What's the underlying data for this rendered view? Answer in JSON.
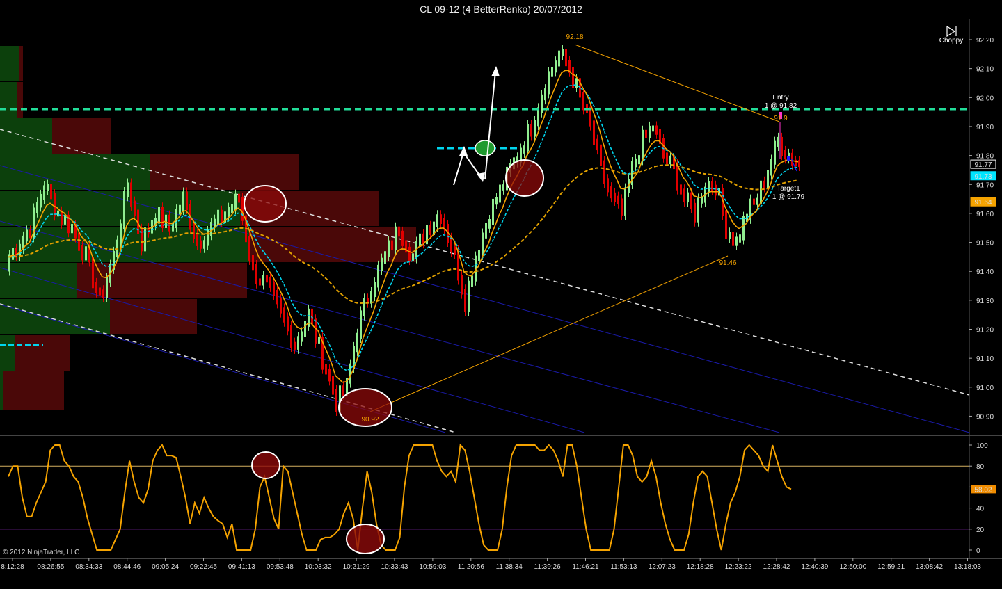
{
  "window": {
    "title": "CL 09-12 (4 BetterRenko)  20/07/2012"
  },
  "toolbar": {
    "choppy_label": "Choppy",
    "choppy_icon": "play-skip-icon"
  },
  "footer": {
    "copyright": "© 2012 NinjaTrader, LLC"
  },
  "price_axis": {
    "ticks": [
      "92.20",
      "92.10",
      "92.00",
      "91.90",
      "91.80",
      "91.70",
      "91.60",
      "91.50",
      "91.40",
      "91.30",
      "91.20",
      "91.10",
      "91.00",
      "90.90"
    ],
    "tags": [
      {
        "text": "91.77",
        "bg": "#000000",
        "fg": "#ffffff",
        "border": "#ffffff",
        "price": 91.77
      },
      {
        "text": "91.73",
        "bg": "#00e5ff",
        "fg": "#000000",
        "border": "#00e5ff",
        "price": 91.73
      },
      {
        "text": "91.64",
        "bg": "#f5a300",
        "fg": "#000000",
        "border": "#f5a300",
        "price": 91.64
      }
    ]
  },
  "osc_axis": {
    "ticks": [
      "100",
      "80",
      "60",
      "40",
      "20",
      "0"
    ],
    "tag": {
      "text": "58.02",
      "bg": "#f08c00",
      "fg": "#000000",
      "value": 58.02
    }
  },
  "time_axis": [
    "8:12:28",
    "08:26:55",
    "08:34:33",
    "08:44:46",
    "09:05:24",
    "09:22:45",
    "09:41:13",
    "09:53:48",
    "10:03:32",
    "10:21:29",
    "10:33:43",
    "10:59:03",
    "11:20:56",
    "11:38:34",
    "11:39:26",
    "11:46:21",
    "11:53:13",
    "12:07:23",
    "12:18:28",
    "12:23:22",
    "12:28:42",
    "12:40:39",
    "12:50:00",
    "12:59:21",
    "13:08:42",
    "13:18:03"
  ],
  "annotations": {
    "swing_high": "92.18",
    "swing_low": "90.92",
    "swing_mid_low": "91.46",
    "entry_title": "Entry",
    "entry_detail": "1 @ 91.82",
    "entry_price_label": "91.9",
    "target_title": "Target1",
    "target_detail": "1 @ 91.79"
  },
  "colors": {
    "up_bar": "#90ee90",
    "down_bar": "#e00000",
    "ema_fast": "#f5a300",
    "ema_cyan": "#00d5ee",
    "sma_slow": "#e0a000",
    "resistance_line": "#22dd99",
    "oscillator": "#f5a300",
    "osc_upper": "#d4b060",
    "osc_lower": "#9b30d0",
    "vol_profile_green": "#0c400c",
    "vol_profile_red": "#4a0808"
  },
  "chart_data": [
    {
      "type": "candlestick",
      "symbol": "CL 09-12",
      "bar_type": "4 BetterRenko",
      "date": "20/07/2012",
      "y_range": [
        90.85,
        92.25
      ],
      "close_path": [
        [
          0,
          91.45
        ],
        [
          6,
          91.55
        ],
        [
          10,
          91.7
        ],
        [
          14,
          91.6
        ],
        [
          18,
          91.55
        ],
        [
          22,
          91.45
        ],
        [
          26,
          91.3
        ],
        [
          30,
          91.45
        ],
        [
          34,
          91.7
        ],
        [
          38,
          91.5
        ],
        [
          42,
          91.6
        ],
        [
          46,
          91.55
        ],
        [
          50,
          91.65
        ],
        [
          54,
          91.5
        ],
        [
          58,
          91.55
        ],
        [
          62,
          91.6
        ],
        [
          66,
          91.65
        ],
        [
          70,
          91.4
        ],
        [
          74,
          91.35
        ],
        [
          78,
          91.25
        ],
        [
          82,
          91.15
        ],
        [
          86,
          91.25
        ],
        [
          90,
          91.1
        ],
        [
          94,
          90.95
        ],
        [
          97,
          91.0
        ],
        [
          100,
          91.2
        ],
        [
          104,
          91.35
        ],
        [
          108,
          91.45
        ],
        [
          112,
          91.55
        ],
        [
          116,
          91.45
        ],
        [
          120,
          91.55
        ],
        [
          124,
          91.6
        ],
        [
          128,
          91.45
        ],
        [
          131,
          91.3
        ],
        [
          134,
          91.45
        ],
        [
          138,
          91.6
        ],
        [
          142,
          91.7
        ],
        [
          146,
          91.8
        ],
        [
          150,
          91.9
        ],
        [
          154,
          92.05
        ],
        [
          158,
          92.15
        ],
        [
          161,
          92.1
        ],
        [
          164,
          92.0
        ],
        [
          167,
          91.9
        ],
        [
          170,
          91.75
        ],
        [
          173,
          91.65
        ],
        [
          176,
          91.6
        ],
        [
          179,
          91.75
        ],
        [
          182,
          91.85
        ],
        [
          185,
          91.9
        ],
        [
          188,
          91.8
        ],
        [
          191,
          91.75
        ],
        [
          194,
          91.65
        ],
        [
          197,
          91.6
        ],
        [
          200,
          91.7
        ],
        [
          203,
          91.7
        ],
        [
          206,
          91.55
        ],
        [
          209,
          91.5
        ],
        [
          212,
          91.6
        ],
        [
          215,
          91.65
        ],
        [
          218,
          91.75
        ],
        [
          221,
          91.85
        ],
        [
          224,
          91.8
        ],
        [
          227,
          91.77
        ]
      ],
      "overlays": [
        {
          "name": "EMA fast",
          "color": "#f5a300",
          "style": "solid"
        },
        {
          "name": "EMA",
          "color": "#00d5ee",
          "style": "dashed"
        },
        {
          "name": "SMA slow",
          "color": "#e0a000",
          "style": "dashed"
        }
      ],
      "horizontal_line": {
        "price": 91.96,
        "color": "#22dd99",
        "style": "dashed"
      },
      "markers": {
        "high": 92.18,
        "low": 90.92,
        "higher_low": 91.46,
        "entry": 91.82,
        "target": 91.79
      }
    },
    {
      "type": "line",
      "name": "oscillator",
      "y_range": [
        0,
        100
      ],
      "levels": [
        80,
        20
      ],
      "last": 58.02,
      "values": [
        70,
        80,
        80,
        50,
        32,
        32,
        45,
        55,
        65,
        95,
        100,
        100,
        85,
        80,
        70,
        65,
        50,
        30,
        15,
        0,
        0,
        0,
        0,
        10,
        20,
        55,
        85,
        65,
        50,
        45,
        58,
        85,
        95,
        100,
        90,
        90,
        88,
        70,
        50,
        25,
        45,
        35,
        50,
        40,
        32,
        28,
        25,
        12,
        25,
        0,
        0,
        0,
        0,
        20,
        60,
        70,
        50,
        30,
        20,
        80,
        75,
        55,
        35,
        15,
        0,
        0,
        0,
        10,
        12,
        12,
        15,
        20,
        35,
        45,
        30,
        0,
        40,
        75,
        55,
        25,
        5,
        0,
        0,
        0,
        12,
        60,
        90,
        100,
        100,
        100,
        100,
        100,
        85,
        75,
        70,
        75,
        65,
        100,
        95,
        75,
        50,
        25,
        5,
        0,
        0,
        0,
        20,
        60,
        90,
        100,
        100,
        100,
        100,
        100,
        95,
        95,
        100,
        95,
        85,
        70,
        100,
        100,
        80,
        50,
        20,
        0,
        0,
        0,
        0,
        0,
        20,
        60,
        100,
        100,
        90,
        70,
        65,
        70,
        85,
        70,
        45,
        25,
        10,
        0,
        0,
        0,
        15,
        45,
        70,
        75,
        70,
        45,
        20,
        0,
        25,
        45,
        55,
        70,
        95,
        100,
        95,
        90,
        80,
        75,
        100,
        85,
        70,
        60,
        58
      ]
    }
  ]
}
